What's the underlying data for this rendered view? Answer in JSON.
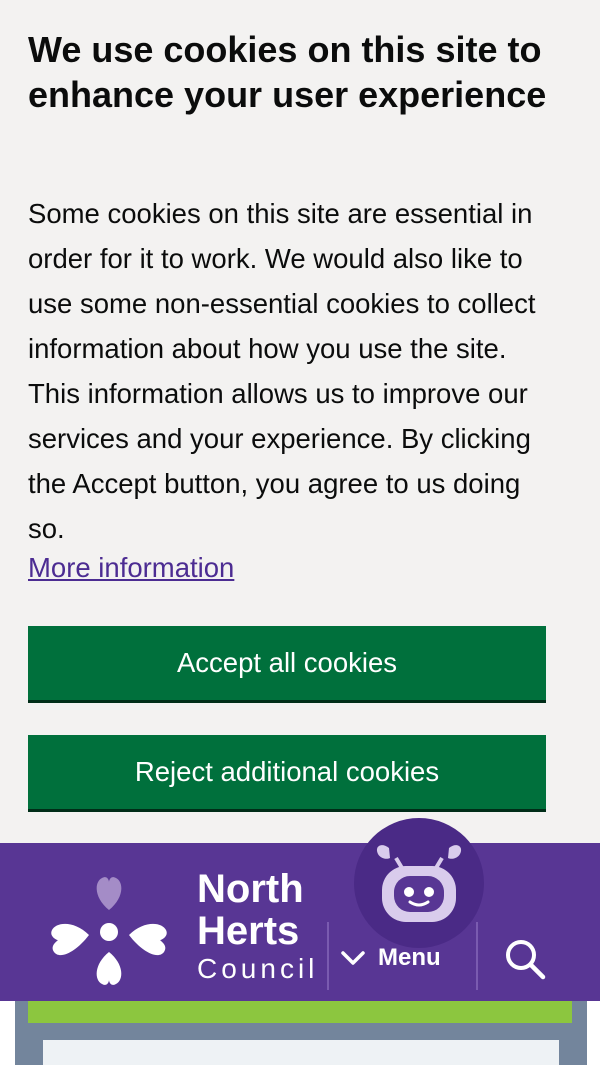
{
  "cookie_banner": {
    "title": "We use cookies on this site to enhance your user experience",
    "body": "Some cookies on this site are essential in order for it to work. We would also like to use some non-essential cookies to collect information about how you use the site. This information allows us to improve our services and your experience. By clicking the Accept button, you agree to us doing so.",
    "more_info_link": "More information",
    "accept_label": "Accept all cookies",
    "reject_label": "Reject additional cookies"
  },
  "header": {
    "logo_line1": "North",
    "logo_line2": "Herts",
    "logo_line3": "Council",
    "menu_label": "Menu",
    "chatbot_icon": "robot-icon",
    "search_icon": "search-icon"
  },
  "colors": {
    "banner_bg": "#f3f2f1",
    "button_green": "#00703c",
    "header_purple": "#583694",
    "link_purple": "#4c2c92",
    "accent_green": "#8cc63f"
  }
}
